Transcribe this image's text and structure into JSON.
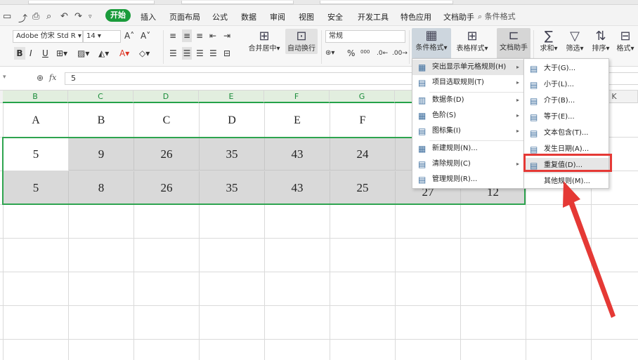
{
  "ribbon_tabs": [
    "插入",
    "页面布局",
    "公式",
    "数据",
    "审阅",
    "视图",
    "安全",
    "开发工具",
    "特色应用",
    "文档助手"
  ],
  "home_tab": "开始",
  "search_placeholder": "条件格式",
  "ribbon": {
    "font_name": "Adobe 仿宋 Std R",
    "font_size": "14",
    "number_format": "常规",
    "merge_center": "合并居中",
    "auto_wrap": "自动换行",
    "percent": "%",
    "thousands": "000",
    "cond_format": "条件格式",
    "table_style": "表格样式",
    "doc_assistant": "文档助手",
    "sum": "求和",
    "filter": "筛选",
    "sort": "排序",
    "format": "格式"
  },
  "formula": {
    "fx": "fx",
    "value": "5"
  },
  "columns": [
    "B",
    "C",
    "D",
    "E",
    "F",
    "G",
    "",
    "",
    "",
    "K"
  ],
  "rows": [
    [
      "A",
      "B",
      "C",
      "D",
      "E",
      "F"
    ],
    [
      "5",
      "9",
      "26",
      "35",
      "43",
      "24"
    ],
    [
      "5",
      "8",
      "26",
      "35",
      "43",
      "25"
    ]
  ],
  "hidden_tail": {
    "r3h": "27",
    "r3i": "12"
  },
  "menu1": [
    {
      "icon": "▦",
      "label": "突出显示单元格规则(H)",
      "submenu": true
    },
    {
      "icon": "▤",
      "label": "项目选取规则(T)",
      "submenu": true
    },
    {
      "icon": "▥",
      "label": "数据条(D)",
      "submenu": true
    },
    {
      "icon": "▦",
      "label": "色阶(S)",
      "submenu": true
    },
    {
      "icon": "▤",
      "label": "图标集(I)",
      "submenu": true
    },
    {
      "icon": "▦",
      "label": "新建规则(N)...",
      "submenu": false
    },
    {
      "icon": "▤",
      "label": "清除规则(C)",
      "submenu": true
    },
    {
      "icon": "▤",
      "label": "管理规则(R)...",
      "submenu": false
    }
  ],
  "menu2": [
    {
      "icon": "▤",
      "label": "大于(G)..."
    },
    {
      "icon": "▤",
      "label": "小于(L)..."
    },
    {
      "icon": "▤",
      "label": "介于(B)..."
    },
    {
      "icon": "▤",
      "label": "等于(E)..."
    },
    {
      "icon": "▤",
      "label": "文本包含(T)..."
    },
    {
      "icon": "▤",
      "label": "发生日期(A)..."
    },
    {
      "icon": "▤",
      "label": "重复值(D)..."
    },
    {
      "icon": "",
      "label": "其他规则(M)..."
    }
  ],
  "colors": {
    "accent": "#1a9b3b",
    "highlight": "#e53935",
    "cell_gray": "#d9d9d9"
  }
}
